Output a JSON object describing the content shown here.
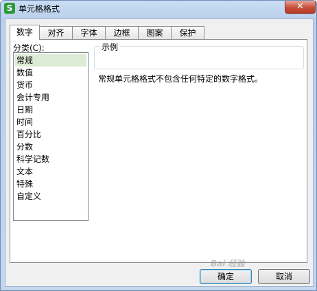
{
  "window": {
    "title": "单元格格式",
    "app_icon_letter": "S",
    "close_label": "✕"
  },
  "tabs": [
    {
      "label": "数字",
      "active": true
    },
    {
      "label": "对齐"
    },
    {
      "label": "字体"
    },
    {
      "label": "边框"
    },
    {
      "label": "图案"
    },
    {
      "label": "保护"
    }
  ],
  "category": {
    "label": "分类(C):",
    "items": [
      "常规",
      "数值",
      "货币",
      "会计专用",
      "日期",
      "时间",
      "百分比",
      "分数",
      "科学记数",
      "文本",
      "特殊",
      "自定义"
    ],
    "selected": "常规"
  },
  "sample": {
    "legend": "示例",
    "value": ""
  },
  "description": "常规单元格格式不包含任何特定的数字格式。",
  "buttons": {
    "ok": "确定",
    "cancel": "取消"
  },
  "watermark": "Bai 经验"
}
